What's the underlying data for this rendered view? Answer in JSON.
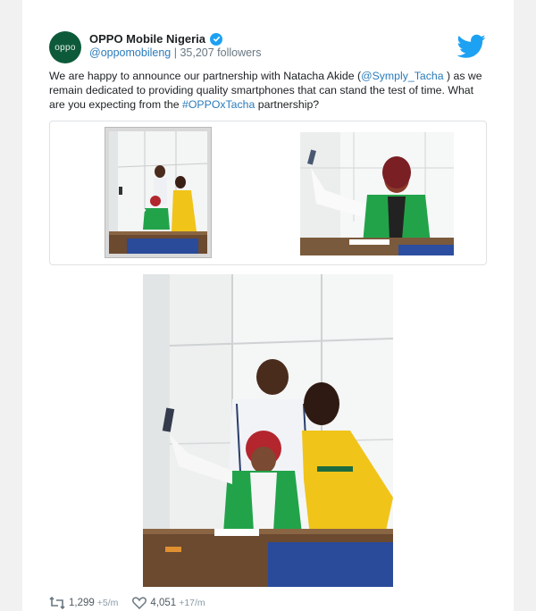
{
  "account": {
    "avatar_text": "oppo",
    "name": "OPPO Mobile Nigeria",
    "handle": "@oppomobileng",
    "separator": " | ",
    "followers": "35,207 followers"
  },
  "tweet": {
    "text_part1": "We are happy to announce our partnership with Natacha Akide (",
    "mention": "@Symply_Tacha",
    "text_part2": " ) as we remain dedicated to providing quality smartphones that can stand the test of time. What are you expecting from the ",
    "hashtag": "#OPPOxTacha",
    "text_part3": " partnership?"
  },
  "stats": {
    "retweets": "1,299",
    "retweets_delta": "+5/m",
    "likes": "4,051",
    "likes_delta": "+17/m"
  },
  "icons": {
    "verified": "verified-badge-icon",
    "twitter": "twitter-bird-icon",
    "retweet": "retweet-icon",
    "like": "heart-icon"
  },
  "colors": {
    "brand_green": "#0d5a3a",
    "twitter_blue": "#1da1f2",
    "link": "#2b7bb9",
    "muted": "#697882"
  }
}
